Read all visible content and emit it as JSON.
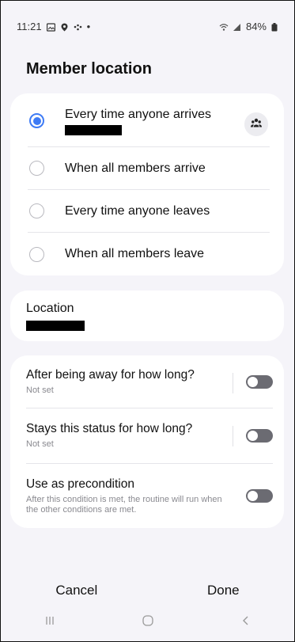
{
  "status_bar": {
    "time": "11:21",
    "battery": "84%"
  },
  "page": {
    "title": "Member location"
  },
  "options": [
    {
      "label": "Every time anyone arrives",
      "selected": true
    },
    {
      "label": "When all members arrive",
      "selected": false
    },
    {
      "label": "Every time anyone leaves",
      "selected": false
    },
    {
      "label": "When all members leave",
      "selected": false
    }
  ],
  "location": {
    "label": "Location"
  },
  "settings": [
    {
      "title": "After being away for how long?",
      "subtitle": "Not set",
      "on": false
    },
    {
      "title": "Stays this status for how long?",
      "subtitle": "Not set",
      "on": false
    },
    {
      "title": "Use as precondition",
      "subtitle": "After this condition is met, the routine will run when the other conditions are met.",
      "on": false
    }
  ],
  "actions": {
    "cancel": "Cancel",
    "done": "Done"
  },
  "icons": {
    "member": "people-icon",
    "nav_recents": "recents-icon",
    "nav_home": "home-icon",
    "nav_back": "back-icon"
  },
  "colors": {
    "accent": "#3e7bf5",
    "background": "#f5f4f9",
    "toggle_off": "#6b6b72"
  }
}
